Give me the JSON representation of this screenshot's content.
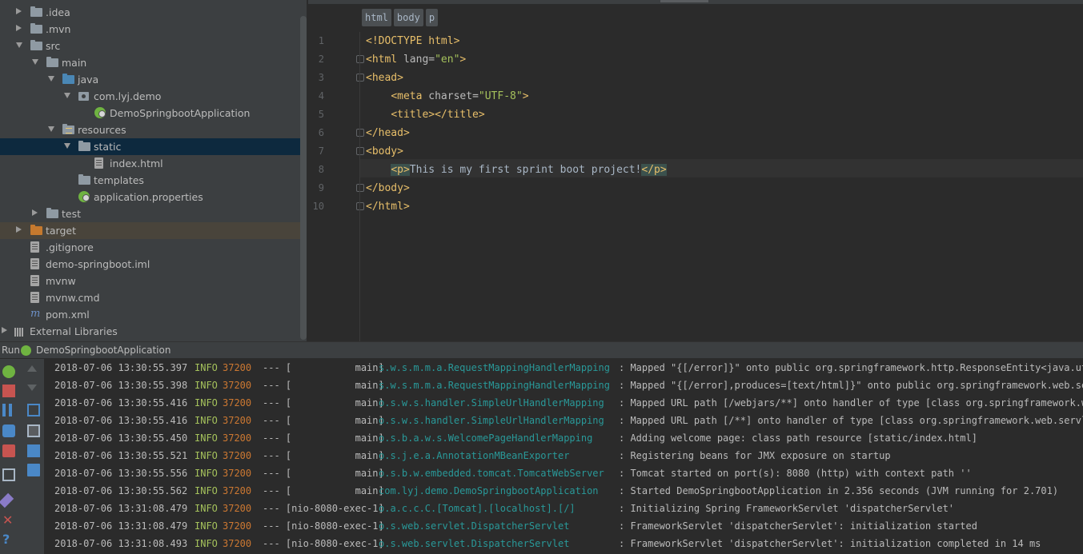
{
  "tree": {
    "items": [
      {
        "label": ".idea",
        "indent": 0,
        "arrow": "right",
        "icon": "folder-icon"
      },
      {
        "label": ".mvn",
        "indent": 0,
        "arrow": "right",
        "icon": "folder-icon"
      },
      {
        "label": "src",
        "indent": 0,
        "arrow": "down",
        "icon": "folder-icon"
      },
      {
        "label": "main",
        "indent": 1,
        "arrow": "down",
        "icon": "folder-icon"
      },
      {
        "label": "java",
        "indent": 2,
        "arrow": "down",
        "icon": "source-folder-icon"
      },
      {
        "label": "com.lyj.demo",
        "indent": 3,
        "arrow": "down",
        "icon": "package-icon"
      },
      {
        "label": "DemoSpringbootApplication",
        "indent": 4,
        "arrow": "",
        "icon": "spring-boot-class-icon"
      },
      {
        "label": "resources",
        "indent": 2,
        "arrow": "down",
        "icon": "resources-folder-icon"
      },
      {
        "label": "static",
        "indent": 3,
        "arrow": "down",
        "icon": "folder-icon",
        "selected": true
      },
      {
        "label": "index.html",
        "indent": 4,
        "arrow": "",
        "icon": "html-file-icon"
      },
      {
        "label": "templates",
        "indent": 3,
        "arrow": "",
        "icon": "folder-icon"
      },
      {
        "label": "application.properties",
        "indent": 3,
        "arrow": "",
        "icon": "spring-properties-icon"
      },
      {
        "label": "test",
        "indent": 1,
        "arrow": "right",
        "icon": "folder-icon"
      },
      {
        "label": "target",
        "indent": 0,
        "arrow": "right",
        "icon": "excluded-folder-icon",
        "highlight": true
      },
      {
        "label": ".gitignore",
        "indent": 0,
        "arrow": "",
        "icon": "text-file-icon"
      },
      {
        "label": "demo-springboot.iml",
        "indent": 0,
        "arrow": "",
        "icon": "module-file-icon"
      },
      {
        "label": "mvnw",
        "indent": 0,
        "arrow": "",
        "icon": "text-file-icon"
      },
      {
        "label": "mvnw.cmd",
        "indent": 0,
        "arrow": "",
        "icon": "text-file-icon"
      },
      {
        "label": "pom.xml",
        "indent": 0,
        "arrow": "",
        "icon": "maven-icon"
      },
      {
        "label": "External Libraries",
        "indent": -1,
        "arrow": "right",
        "icon": "libraries-icon"
      }
    ]
  },
  "editor": {
    "breadcrumbs": [
      "html",
      "body",
      "p"
    ],
    "line_numbers": [
      "1",
      "2",
      "3",
      "4",
      "5",
      "6",
      "7",
      "8",
      "9",
      "10"
    ],
    "lines": [
      [
        {
          "t": "<!DOCTYPE html>",
          "c": "tag"
        }
      ],
      [
        {
          "t": "<html ",
          "c": "tag"
        },
        {
          "t": "lang=",
          "c": "attr"
        },
        {
          "t": "\"en\"",
          "c": "val"
        },
        {
          "t": ">",
          "c": "tag"
        }
      ],
      [
        {
          "t": "<head>",
          "c": "tag"
        }
      ],
      [
        {
          "t": "    ",
          "c": ""
        },
        {
          "t": "<meta ",
          "c": "tag"
        },
        {
          "t": "charset=",
          "c": "attr"
        },
        {
          "t": "\"UTF-8\"",
          "c": "val"
        },
        {
          "t": ">",
          "c": "tag"
        }
      ],
      [
        {
          "t": "    ",
          "c": ""
        },
        {
          "t": "<title></title>",
          "c": "tag"
        }
      ],
      [
        {
          "t": "</head>",
          "c": "tag"
        }
      ],
      [
        {
          "t": "<body>",
          "c": "tag"
        }
      ],
      [
        {
          "t": "    ",
          "c": ""
        },
        {
          "t": "<p>",
          "c": "tag box"
        },
        {
          "t": "This is my first sprint boot project!",
          "c": ""
        },
        {
          "t": "</p>",
          "c": "tag box"
        }
      ],
      [
        {
          "t": "</body>",
          "c": "tag"
        }
      ],
      [
        {
          "t": "</html>",
          "c": "tag"
        }
      ]
    ]
  },
  "run": {
    "label": "Run",
    "config": "DemoSpringbootApplication",
    "log": [
      [
        "2018-07-06 13:30:55.397",
        "INFO",
        "37200",
        "--- [           main]",
        "s.w.s.m.m.a.RequestMappingHandlerMapping",
        ": Mapped \"{[/error]}\" onto public org.springframework.http.ResponseEntity<java.util.M"
      ],
      [
        "2018-07-06 13:30:55.398",
        "INFO",
        "37200",
        "--- [           main]",
        "s.w.s.m.m.a.RequestMappingHandlerMapping",
        ": Mapped \"{[/error],produces=[text/html]}\" onto public org.springframework.web.servle"
      ],
      [
        "2018-07-06 13:30:55.416",
        "INFO",
        "37200",
        "--- [           main]",
        "o.s.w.s.handler.SimpleUrlHandlerMapping",
        ": Mapped URL path [/webjars/**] onto handler of type [class org.springframework.web.s"
      ],
      [
        "2018-07-06 13:30:55.416",
        "INFO",
        "37200",
        "--- [           main]",
        "o.s.w.s.handler.SimpleUrlHandlerMapping",
        ": Mapped URL path [/**] onto handler of type [class org.springframework.web.servlet.r"
      ],
      [
        "2018-07-06 13:30:55.450",
        "INFO",
        "37200",
        "--- [           main]",
        "o.s.b.a.w.s.WelcomePageHandlerMapping",
        ": Adding welcome page: class path resource [static/index.html]"
      ],
      [
        "2018-07-06 13:30:55.521",
        "INFO",
        "37200",
        "--- [           main]",
        "o.s.j.e.a.AnnotationMBeanExporter",
        ": Registering beans for JMX exposure on startup"
      ],
      [
        "2018-07-06 13:30:55.556",
        "INFO",
        "37200",
        "--- [           main]",
        "o.s.b.w.embedded.tomcat.TomcatWebServer",
        ": Tomcat started on port(s): 8080 (http) with context path ''"
      ],
      [
        "2018-07-06 13:30:55.562",
        "INFO",
        "37200",
        "--- [           main]",
        "com.lyj.demo.DemoSpringbootApplication",
        ": Started DemoSpringbootApplication in 2.356 seconds (JVM running for 2.701)"
      ],
      [
        "2018-07-06 13:31:08.479",
        "INFO",
        "37200",
        "--- [nio-8080-exec-1]",
        "o.a.c.c.C.[Tomcat].[localhost].[/]",
        ": Initializing Spring FrameworkServlet 'dispatcherServlet'"
      ],
      [
        "2018-07-06 13:31:08.479",
        "INFO",
        "37200",
        "--- [nio-8080-exec-1]",
        "o.s.web.servlet.DispatcherServlet",
        ": FrameworkServlet 'dispatcherServlet': initialization started"
      ],
      [
        "2018-07-06 13:31:08.493",
        "INFO",
        "37200",
        "--- [nio-8080-exec-1]",
        "o.s.web.servlet.DispatcherServlet",
        ": FrameworkServlet 'dispatcherServlet': initialization completed in 14 ms"
      ]
    ],
    "toolbar_icons": [
      "rerun-icon",
      "scroll-up-icon",
      "stop-icon",
      "scroll-down-icon",
      "pause-icon",
      "soft-wrap-icon",
      "camera-icon",
      "scroll-to-end-icon",
      "exit-icon",
      "print-icon",
      "layout-icon",
      "clear-all-icon",
      "pin-icon",
      "close-icon",
      "help-icon"
    ]
  },
  "colors": {
    "tree_bg": "#3c3f41",
    "editor_bg": "#2b2b2b",
    "selection": "#0d293e",
    "tag": "#e8bf6a",
    "string": "#a5c25c",
    "logger": "#299999",
    "pid": "#cc7832"
  }
}
